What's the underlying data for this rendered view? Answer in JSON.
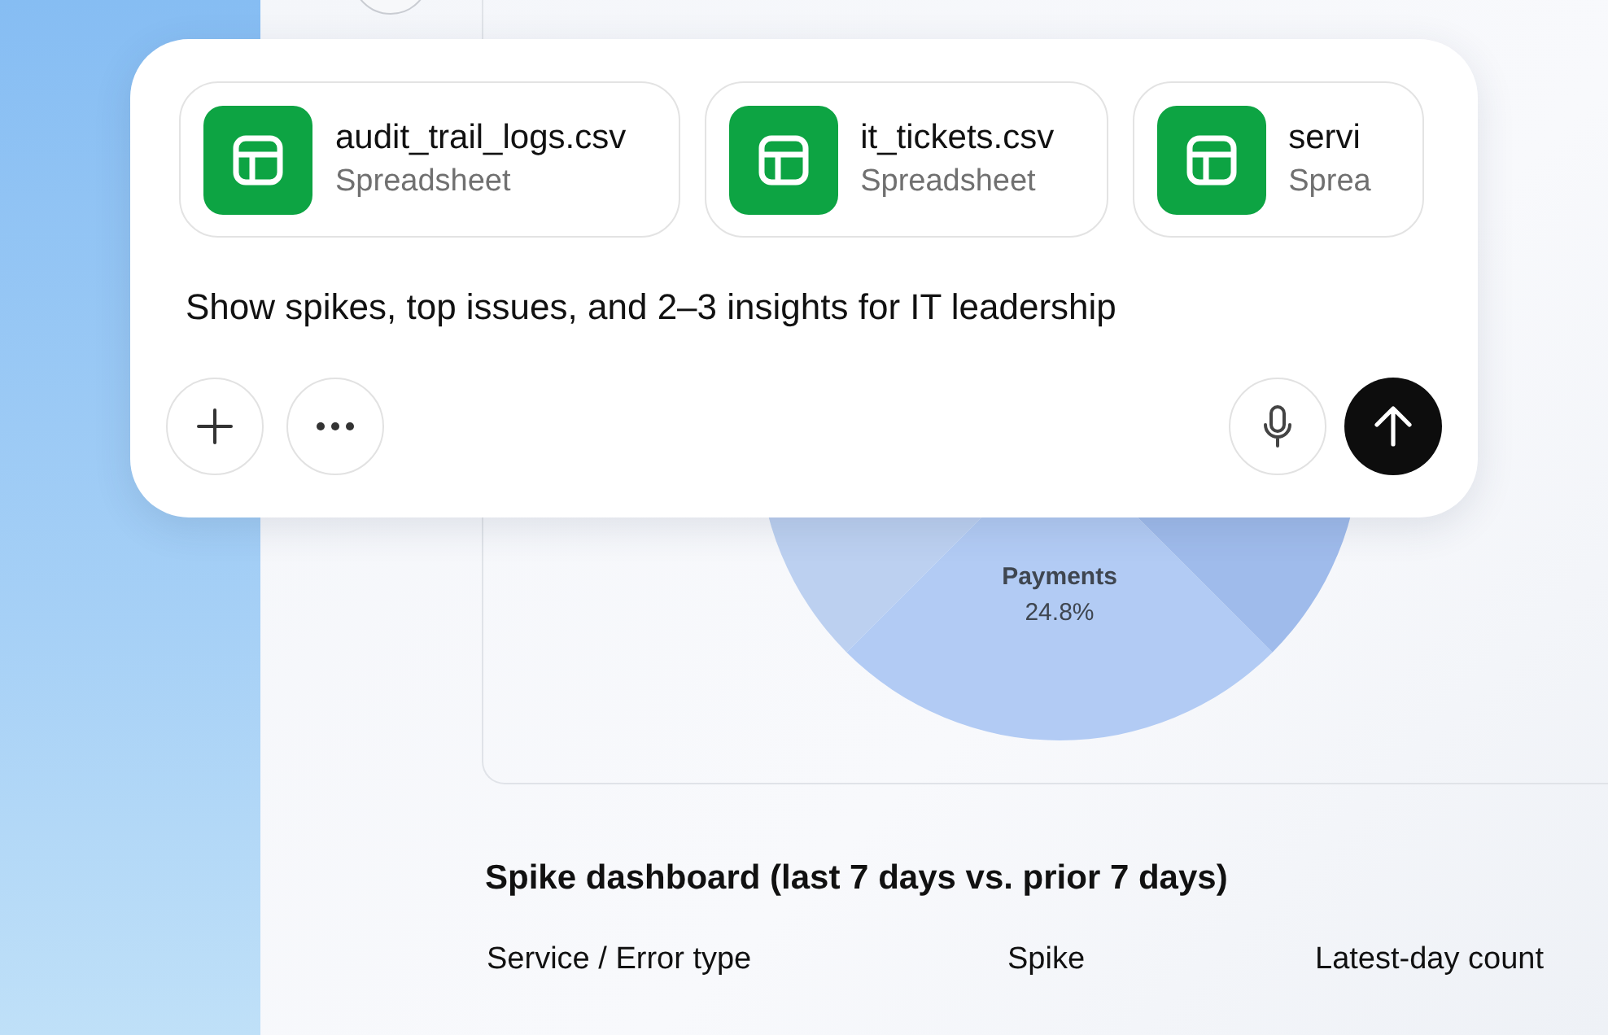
{
  "attachments": [
    {
      "name": "audit_trail_logs.csv",
      "type": "Spreadsheet"
    },
    {
      "name": "it_tickets.csv",
      "type": "Spreadsheet"
    },
    {
      "name": "servi",
      "type": "Sprea"
    }
  ],
  "prompt": "Show spikes, top issues, and 2–3 insights for IT leadership",
  "pie_chart": {
    "slice_label": "Payments",
    "slice_value": "24.8%"
  },
  "spike_dashboard": {
    "title": "Spike dashboard (last 7 days vs. prior 7 days)",
    "columns": [
      "Service / Error type",
      "Spike",
      "Latest-day count"
    ]
  }
}
